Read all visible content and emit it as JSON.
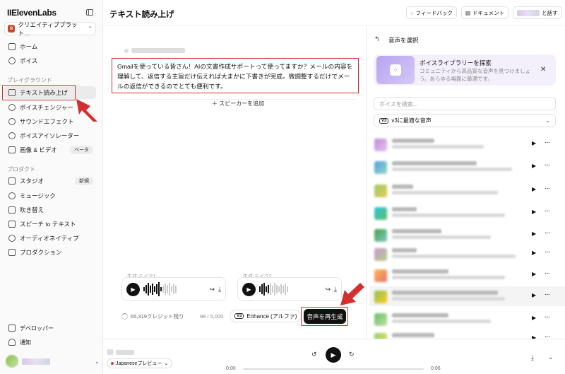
{
  "app": {
    "logo": "IIElevenLabs",
    "workspace": "クリエイティブプラット…"
  },
  "sidebar": {
    "items_top": [
      {
        "label": "ホーム"
      },
      {
        "label": "ボイス"
      }
    ],
    "section_playground": "プレイグラウンド",
    "items_playground": [
      {
        "label": "テキスト読み上げ",
        "active": true
      },
      {
        "label": "ボイスチェンジャー"
      },
      {
        "label": "サウンドエフェクト"
      },
      {
        "label": "ボイスアイソレーター"
      },
      {
        "label": "画像 & ビデオ",
        "badge": "ベータ"
      }
    ],
    "section_product": "プロダクト",
    "items_product": [
      {
        "label": "スタジオ",
        "badge": "新規"
      },
      {
        "label": "ミュージック"
      },
      {
        "label": "吹き替え"
      },
      {
        "label": "スピーチ to テキスト"
      },
      {
        "label": "オーディオネイティブ"
      },
      {
        "label": "プロダクション"
      }
    ],
    "items_bottom": [
      {
        "label": "デベロッパー"
      },
      {
        "label": "通知"
      }
    ]
  },
  "header": {
    "title": "テキスト読み上げ",
    "feedback": "フィードバック",
    "docs": "ドキュメント",
    "talk": "と話す"
  },
  "editor": {
    "text": "Gmailを使っている皆さん！AIの文書作成サポートって使ってますか？メールの内容を理解して、返信する主旨だけ伝えれば大まかに下書きが完成。微調整するだけでメールの返信ができるのでとても便利です。",
    "add_speaker": "スピーカーを追加",
    "take1": "生成:テイク1",
    "take2": "生成:テイク2",
    "credits": "65,319クレジット残り",
    "char_count": "98 / 5,000",
    "enhance_badge": "V3",
    "enhance": "Enhance (アルファ)",
    "regenerate": "音声を再生成"
  },
  "right_panel": {
    "title": "音声を選択",
    "library_title": "ボイスライブラリーを探索",
    "library_desc": "コミュニティから高品質な音声を見つけましょう。あらゆる場面に最適です。",
    "search_placeholder": "ボイスを検索...",
    "filter_badge": "V3",
    "filter": "v3に最適な音声"
  },
  "player": {
    "language": "Japaneseプレビュー",
    "time_start": "0:00",
    "time_end": "0:06"
  }
}
